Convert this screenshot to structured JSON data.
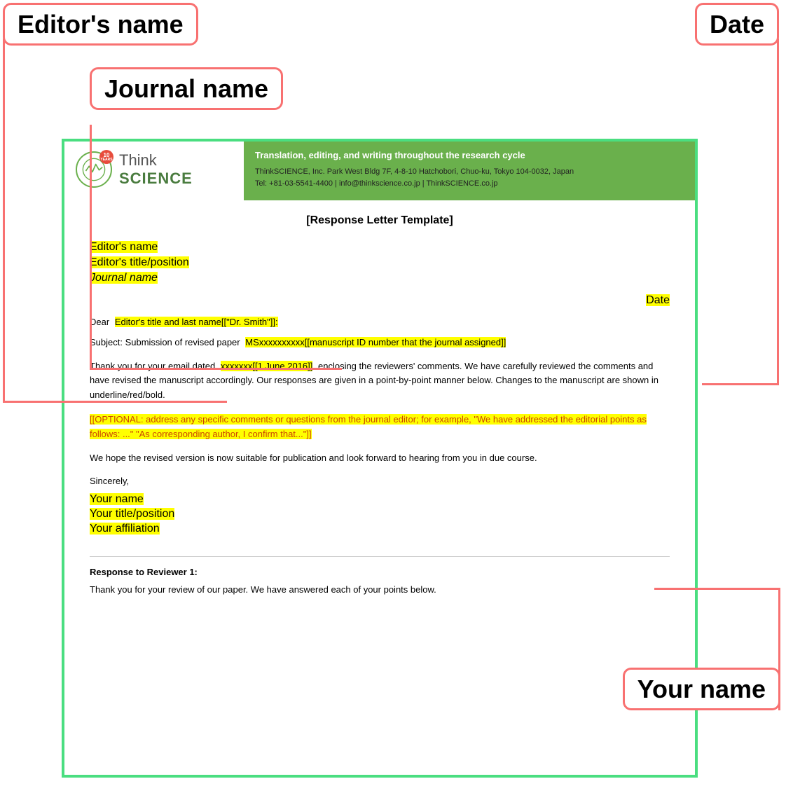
{
  "annotations": {
    "editors_name_label": "Editor's name",
    "date_label": "Date",
    "journal_name_label": "Journal name",
    "your_name_label": "Your name"
  },
  "header": {
    "logo_years": "10",
    "logo_years_sub": "YEARS",
    "logo_think": "Think",
    "logo_science": "SCIENCE",
    "tagline": "Translation, editing, and writing throughout the research cycle",
    "contact_line1": "ThinkSCIENCE, Inc.  Park West Bldg 7F, 4-8-10 Hatchobori, Chuo-ku, Tokyo 104-0032, Japan",
    "contact_line2": "Tel: +81-03-5541-4400 | info@thinkscience.co.jp | ThinkSCIENCE.co.jp"
  },
  "document": {
    "title": "[Response Letter Template]",
    "editor_name": "Editor's name",
    "editor_title": "Editor's title/position",
    "journal_name": "Journal name",
    "date": "Date",
    "salutation": "Dear",
    "salutation_highlight": "Editor's title and last name[[\"Dr. Smith\"]]:",
    "subject_prefix": "Subject:  Submission of revised paper",
    "subject_highlight": "MSxxxxxxxxxx[[manuscript ID number that the journal assigned]]",
    "body1_prefix": "Thank you for your email dated",
    "body1_highlight": "xxxxxxx[[1 June 2016]]",
    "body1_suffix": "enclosing the reviewers' comments. We have carefully reviewed the comments and have revised the manuscript accordingly. Our responses are given in a point-by-point manner below. Changes to the manuscript are shown in underline/red/bold.",
    "optional_text": "[[OPTIONAL: address any specific comments or questions from the journal editor; for example, \"We have addressed the editorial points as follows: ...\" \"As corresponding author, I confirm that...\"]]",
    "body2": "We hope the revised version is now suitable for publication and look forward to hearing from you in due course.",
    "sincerely": "Sincerely,",
    "your_name": "Your name",
    "your_title": "Your title/position",
    "your_affiliation": "Your affiliation",
    "reviewer_heading": "Response to Reviewer 1:",
    "reviewer_text": "Thank you for your review of our paper. We have answered each of your points below."
  }
}
